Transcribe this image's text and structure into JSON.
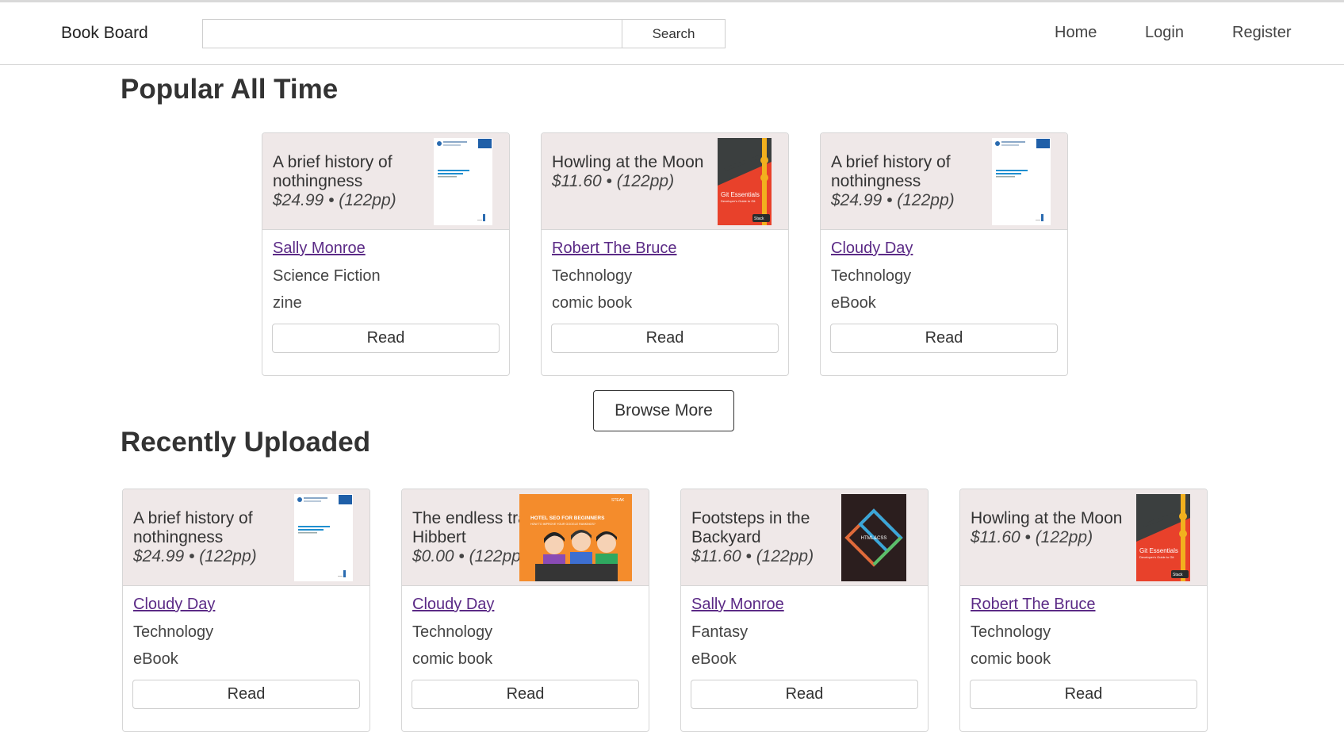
{
  "navbar": {
    "brand": "Book Board",
    "search_button": "Search",
    "links": {
      "home": "Home",
      "login": "Login",
      "register": "Register"
    }
  },
  "popular": {
    "title": "Popular All Time",
    "books": [
      {
        "title": "A brief history of nothingness",
        "meta": "$24.99 • (122pp)",
        "author": "Sally Monroe",
        "genre": "Science Fiction",
        "format": "zine",
        "read_label": "Read",
        "cover": "document-cover"
      },
      {
        "title": "Howling at the Moon",
        "meta": "$11.60 • (122pp)",
        "author": "Robert The Bruce",
        "genre": "Technology",
        "format": "comic book",
        "read_label": "Read",
        "cover": "git-essentials-cover"
      },
      {
        "title": "A brief history of nothingness",
        "meta": "$24.99 • (122pp)",
        "author": "Cloudy Day",
        "genre": "Technology",
        "format": "eBook",
        "read_label": "Read",
        "cover": "document-cover"
      }
    ]
  },
  "browse_more": "Browse More",
  "recent": {
    "title": "Recently Uploaded",
    "books": [
      {
        "title": "A brief history of nothingness",
        "meta": "$24.99 • (122pp)",
        "author": "Cloudy Day",
        "genre": "Technology",
        "format": "eBook",
        "read_label": "Read",
        "cover": "document-cover"
      },
      {
        "title": "The endless trails of Hibbert",
        "meta": "$0.00 • (122pp)",
        "author": "Cloudy Day",
        "genre": "Technology",
        "format": "comic book",
        "read_label": "Read",
        "cover": "hotel-seo-cover"
      },
      {
        "title": "Footsteps in the Backyard",
        "meta": "$11.60 • (122pp)",
        "author": "Sally Monroe",
        "genre": "Fantasy",
        "format": "eBook",
        "read_label": "Read",
        "cover": "html-css-cover"
      },
      {
        "title": "Howling at the Moon",
        "meta": "$11.60 • (122pp)",
        "author": "Robert The Bruce",
        "genre": "Technology",
        "format": "comic book",
        "read_label": "Read",
        "cover": "git-essentials-cover"
      }
    ]
  },
  "cover_text": {
    "git_title": "Git Essentials",
    "git_subtitle": "Developer's Guide to Git",
    "git_publisher": "Stack",
    "seo_brand": "STEAK",
    "seo_title": "HOTEL SEO FOR BEGINNERS",
    "seo_subtitle": "HOW TO IMPROVE YOUR GOOGLE RANKINGS?",
    "htmlcss_title": "HTML&CSS"
  }
}
